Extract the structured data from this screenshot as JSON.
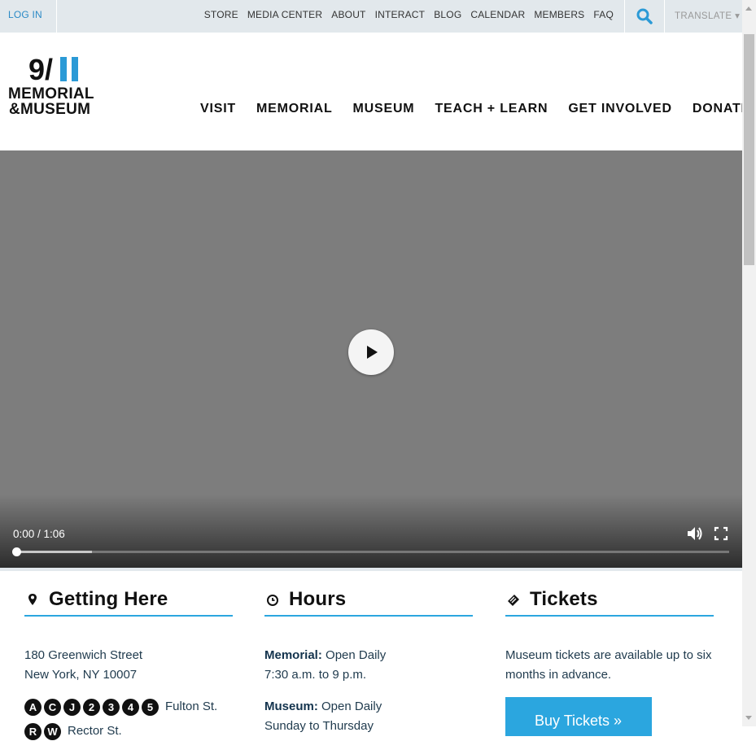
{
  "topbar": {
    "login": "LOG IN",
    "links": [
      "STORE",
      "MEDIA CENTER",
      "ABOUT",
      "INTERACT",
      "BLOG",
      "CALENDAR",
      "MEMBERS",
      "FAQ"
    ],
    "translate": "TRANSLATE ▾"
  },
  "logo": {
    "number_9": "9/",
    "line1": "MEMORIAL",
    "line2": "&MUSEUM"
  },
  "mainnav": [
    "VISIT",
    "MEMORIAL",
    "MUSEUM",
    "TEACH + LEARN",
    "GET INVOLVED",
    "DONATE"
  ],
  "video": {
    "time": "0:00 / 1:06",
    "buffered_fraction": 0.105,
    "played_fraction": 0.0
  },
  "getting_here": {
    "title": "Getting Here",
    "address1": "180 Greenwich Street",
    "address2": "New York, NY 10007",
    "subway_lines": [
      "A",
      "C",
      "J",
      "2",
      "3",
      "4",
      "5"
    ],
    "subway_stop": "Fulton St.",
    "next_lines": [
      "R",
      "W"
    ],
    "next_stop": "Rector St."
  },
  "hours": {
    "title": "Hours",
    "memorial_label": "Memorial:",
    "memorial_value": " Open Daily",
    "memorial_hours": "7:30 a.m. to 9 p.m.",
    "museum_label": "Museum:",
    "museum_value": " Open Daily",
    "museum_days": "Sunday to Thursday"
  },
  "tickets": {
    "title": "Tickets",
    "text": "Museum tickets are available up to six months in advance.",
    "button": "Buy Tickets »"
  },
  "colors": {
    "accent": "#2ba6df",
    "topbar": "#e2e8ec",
    "video_bg": "#7d7d7d"
  }
}
